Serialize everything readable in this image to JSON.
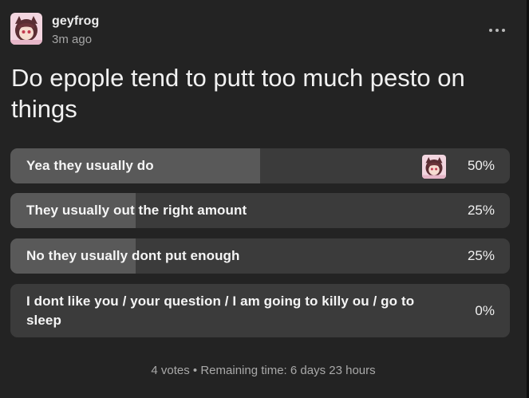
{
  "post": {
    "username": "geyfrog",
    "time_ago": "3m ago",
    "more_icon": "ellipsis-icon",
    "avatar_icon": "avatar-anime-girl"
  },
  "poll": {
    "question": "Do epople tend to putt too much pesto on things",
    "options": [
      {
        "label": "Yea they usually do",
        "percent_text": "50%",
        "percent": 50,
        "voted": true
      },
      {
        "label": "They usually out the right amount",
        "percent_text": "25%",
        "percent": 25,
        "voted": false
      },
      {
        "label": "No they usually dont put enough",
        "percent_text": "25%",
        "percent": 25,
        "voted": false
      },
      {
        "label": "I dont like you / your question / I am going to killy ou / go to sleep",
        "percent_text": "0%",
        "percent": 0,
        "voted": false
      }
    ],
    "votes_text": "4 votes",
    "separator": "•",
    "remaining_text": "Remaining time: 6 days 23 hours"
  },
  "colors": {
    "card_bg": "#232323",
    "option_bg": "#3b3b3b",
    "option_fill": "#595959",
    "text_primary": "#f1f1f1",
    "text_secondary": "#a6a6a6"
  }
}
